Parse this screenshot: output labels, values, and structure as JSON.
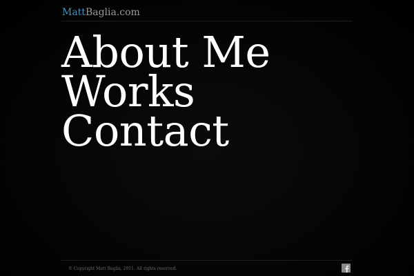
{
  "header": {
    "logo_first": "Matt",
    "logo_rest": "Baglia.com"
  },
  "nav": {
    "items": [
      {
        "label": "About Me"
      },
      {
        "label": "Works"
      },
      {
        "label": "Contact"
      }
    ]
  },
  "footer": {
    "copyright": "© Copyright Matt Baglia, 2011. All rights reserved.",
    "social_icon": "facebook-icon"
  },
  "colors": {
    "background": "#000000",
    "logo_accent": "#4a90b8",
    "nav_text": "#ffffff",
    "muted_text": "#6a6a6a"
  }
}
